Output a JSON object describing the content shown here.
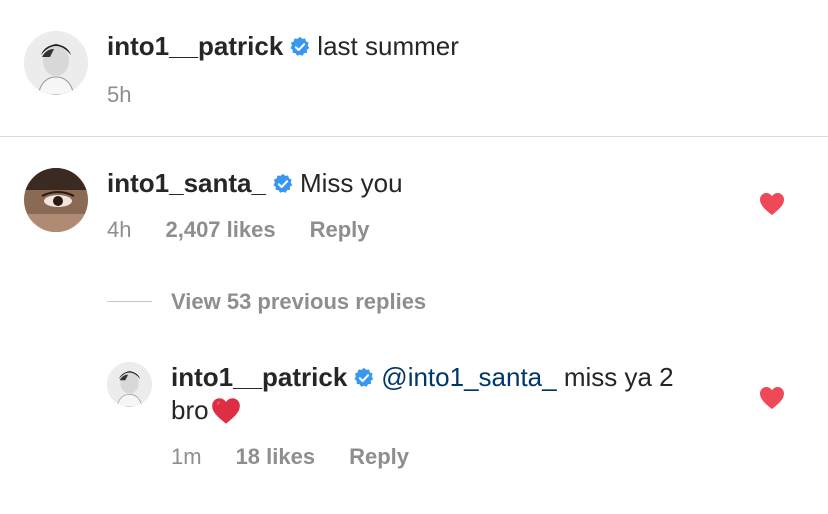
{
  "post_caption": {
    "username": "into1__patrick",
    "text": "last summer",
    "time": "5h"
  },
  "comment": {
    "username": "into1_santa_",
    "text": "Miss you",
    "time": "4h",
    "likes": "2,407 likes",
    "reply_label": "Reply",
    "liked": true
  },
  "view_replies": {
    "label": "View 53 previous replies"
  },
  "reply": {
    "username": "into1__patrick",
    "mention": "@into1_santa_",
    "text_line1": " miss ya 2",
    "text_line2": "bro",
    "emoji": "❤️",
    "time": "1m",
    "likes": "18 likes",
    "reply_label": "Reply",
    "liked": true
  },
  "colors": {
    "verified_badge": "#3897f0",
    "like_heart": "#ed4956",
    "mention": "#00376b",
    "meta_text": "#8e8e8e"
  },
  "icons": {
    "verified": "verified-badge-icon",
    "like": "heart-icon"
  }
}
